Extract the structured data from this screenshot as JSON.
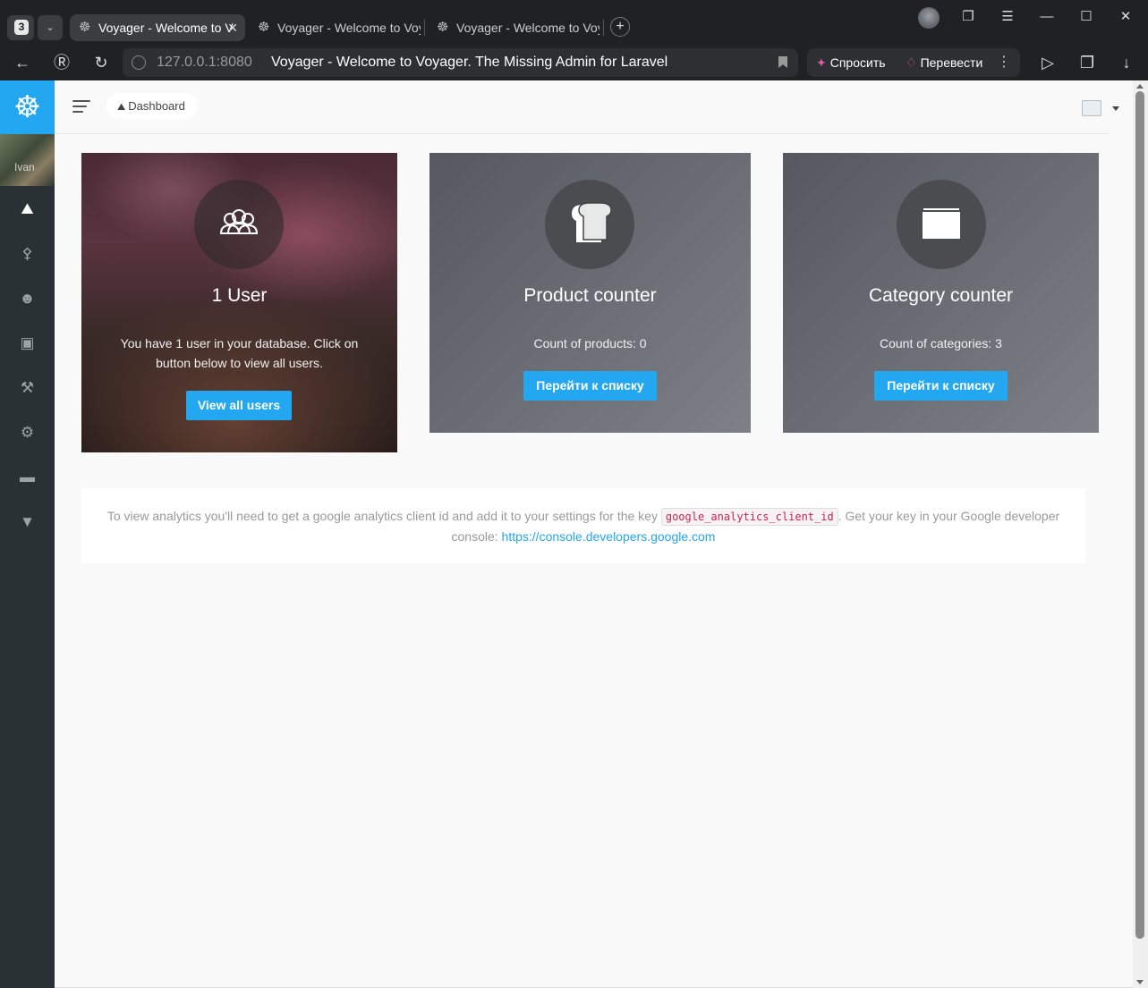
{
  "browser": {
    "tab_count": "3",
    "tabs": [
      {
        "title": "Voyager - Welcome to V"
      },
      {
        "title": "Voyager - Welcome to Voy"
      },
      {
        "title": "Voyager - Welcome to Voy"
      }
    ],
    "address": {
      "host": "127.0.0.1:8080",
      "page_title": "Voyager - Welcome to Voyager. The Missing Admin for Laravel"
    },
    "ask_label": "Спросить",
    "translate_label": "Перевести"
  },
  "topbar": {
    "breadcrumb": "Dashboard"
  },
  "sidebar": {
    "avatar_name": "Ivan",
    "items": [
      {
        "icon": "dashboard-boat-icon"
      },
      {
        "icon": "lock-icon"
      },
      {
        "icon": "person-icon"
      },
      {
        "icon": "images-icon"
      },
      {
        "icon": "tools-icon"
      },
      {
        "icon": "settings-icon"
      },
      {
        "icon": "categories-icon"
      },
      {
        "icon": "compass-icon"
      }
    ]
  },
  "cards": [
    {
      "icon": "users-icon",
      "title": "1 User",
      "text": "You have 1 user in your database. Click on button below to view all users.",
      "button": "View all users"
    },
    {
      "icon": "bread-icon",
      "title": "Product counter",
      "text": "Count of products: 0",
      "button": "Перейти к списку"
    },
    {
      "icon": "folder-icon",
      "title": "Category counter",
      "text": "Count of categories: 3",
      "button": "Перейти к списку"
    }
  ],
  "analytics": {
    "text_before": "To view analytics you'll need to get a google analytics client id and add it to your settings for the key",
    "key": "google_analytics_client_id",
    "text_after": ". Get your key in your Google developer console:",
    "link": "https://console.developers.google.com"
  },
  "colors": {
    "accent": "#22A7F0",
    "sidebar": "#2a3135",
    "card_gray": "#6d7177"
  }
}
